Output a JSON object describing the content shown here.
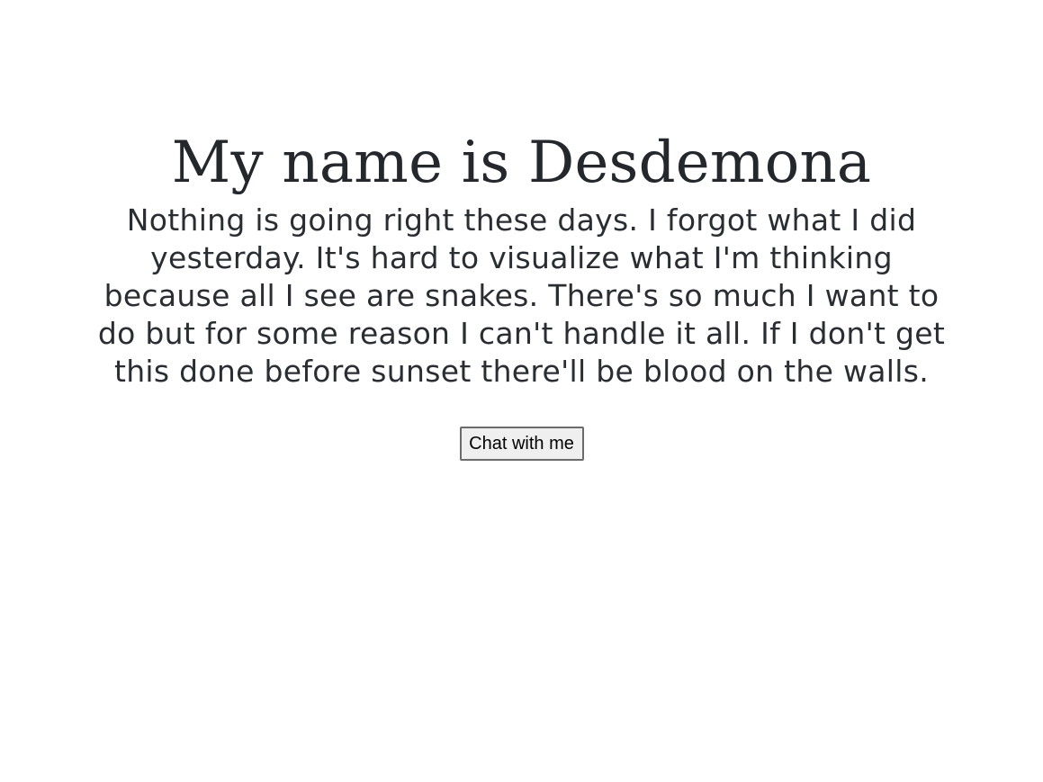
{
  "header": {
    "title": "My name is Desdemona"
  },
  "main": {
    "message": "Nothing is going right these days. I forgot what I did yesterday. It's hard to visualize what I'm thinking because all I see are snakes. There's so much I want to do but for some reason I can't handle it all. If I don't get this done before sunset there'll be blood on the walls.",
    "chat_button_label": "Chat with me"
  }
}
